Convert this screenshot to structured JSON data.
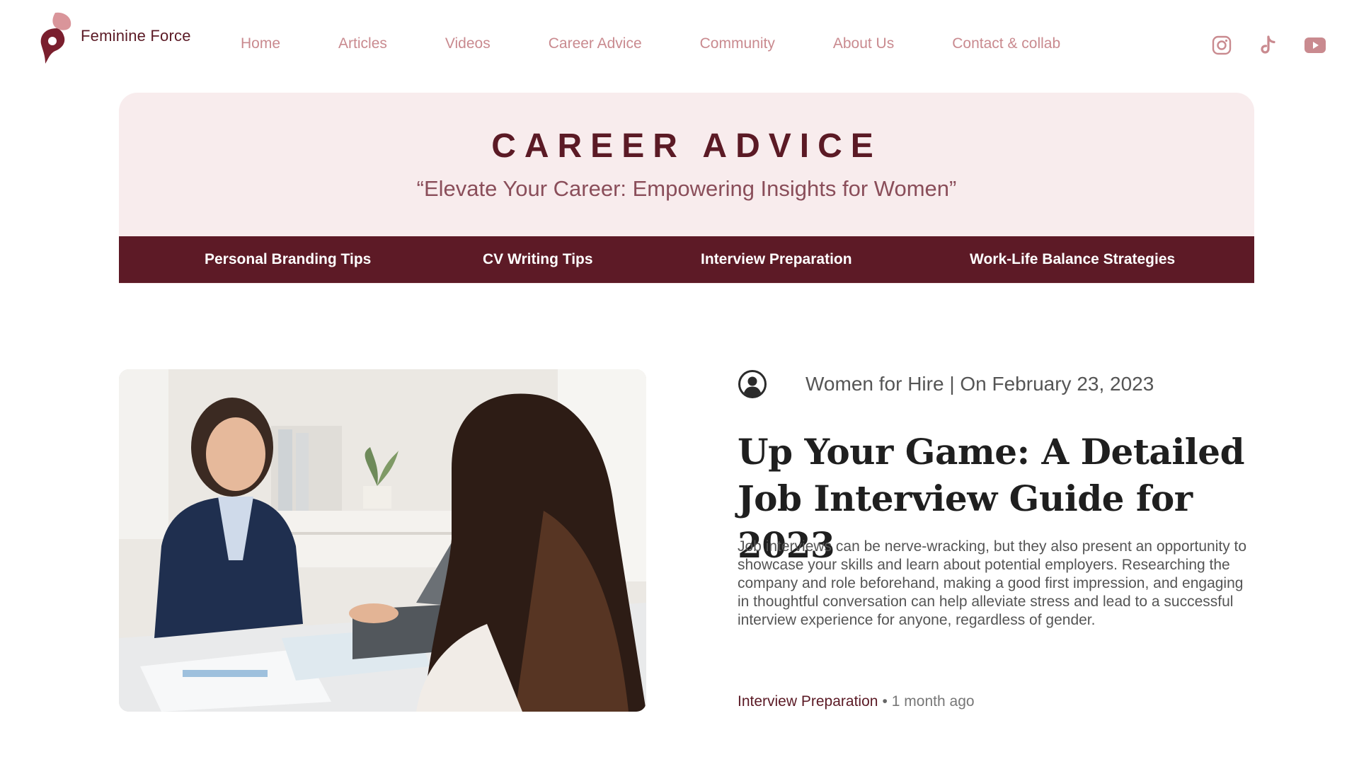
{
  "brand": {
    "name": "Feminine Force"
  },
  "nav": {
    "items": [
      {
        "label": "Home"
      },
      {
        "label": "Articles"
      },
      {
        "label": "Videos"
      },
      {
        "label": "Career Advice"
      },
      {
        "label": "Community"
      },
      {
        "label": "About Us"
      },
      {
        "label": "Contact & collab"
      }
    ]
  },
  "social": {
    "icons": [
      "instagram-icon",
      "tiktok-icon",
      "youtube-icon"
    ]
  },
  "hero": {
    "title": "CAREER ADVICE",
    "subtitle": "“Elevate Your Career: Empowering Insights for Women”"
  },
  "categories": [
    {
      "label": "Personal Branding Tips"
    },
    {
      "label": "CV Writing Tips"
    },
    {
      "label": "Interview Preparation"
    },
    {
      "label": "Work-Life Balance Strategies"
    }
  ],
  "article": {
    "author_icon": "user-circle-icon",
    "meta": "Women for Hire | On February 23, 2023",
    "title": "Up Your Game: A Detailed Job Interview Guide for 2023",
    "excerpt": "Job interviews can be nerve-wracking, but they also present an opportunity to showcase your skills and learn about potential employers. Researching the company and role beforehand, making a good first impression, and engaging in thoughtful conversation can help alleviate stress and lead to a successful interview experience for anyone, regardless of gender.",
    "category": "Interview Preparation",
    "separator": "•",
    "posted": "1 month ago"
  },
  "colors": {
    "brand_dark": "#5b1a25",
    "nav_text": "#c98a8f",
    "hero_bg": "#f8eced",
    "category_bar": "#5d1a26"
  }
}
